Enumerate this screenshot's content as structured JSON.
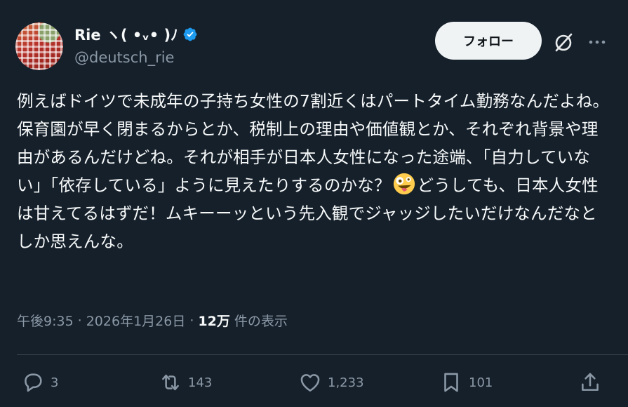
{
  "author": {
    "display_name": "Rie ヽ( •ᵥ• )ﾉ",
    "handle": "@deutsch_rie"
  },
  "follow_button": "フォロー",
  "tweet": {
    "text_before_emoji": "例えばドイツで未成年の子持ち女性の7割近くはパートタイム勤務なんだよね。保育園が早く閉まるからとか、税制上の理由や価値観とか、それぞれ背景や理由があるんだけどね。それが相手が日本人女性になった途端、「自力していない」「依存している」ように見えたりするのかな？",
    "emoji": "zany-face",
    "text_after_emoji": "どうしても、日本人女性は甘えてるはずだ！ムキーーッという先入観でジャッジしたいだけなんだなとしか思えんな。"
  },
  "meta": {
    "time": "午後9:35",
    "separator": "·",
    "date": "2026年1月26日",
    "views_count": "12万",
    "views_label": "件の表示"
  },
  "actions": {
    "replies": "3",
    "reposts": "143",
    "likes": "1,233",
    "bookmarks": "101"
  },
  "colors": {
    "background": "#15202b",
    "text": "#f7f9f9",
    "secondary": "#8b98a5",
    "verified": "#1d9bf0"
  }
}
